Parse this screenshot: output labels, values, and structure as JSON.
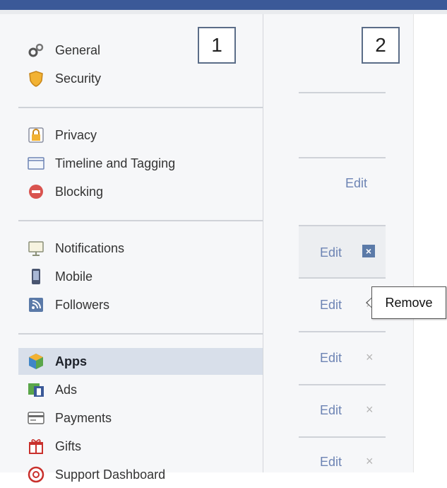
{
  "callouts": {
    "left": "1",
    "right": "2"
  },
  "sidebar": {
    "groups": [
      {
        "items": [
          {
            "label": "General",
            "icon": "gears-icon"
          },
          {
            "label": "Security",
            "icon": "shield-icon"
          }
        ]
      },
      {
        "items": [
          {
            "label": "Privacy",
            "icon": "lock-icon"
          },
          {
            "label": "Timeline and Tagging",
            "icon": "timeline-icon"
          },
          {
            "label": "Blocking",
            "icon": "blocking-icon"
          }
        ]
      },
      {
        "items": [
          {
            "label": "Notifications",
            "icon": "notifications-icon"
          },
          {
            "label": "Mobile",
            "icon": "mobile-icon"
          },
          {
            "label": "Followers",
            "icon": "followers-icon"
          }
        ]
      },
      {
        "items": [
          {
            "label": "Apps",
            "icon": "apps-icon",
            "active": true
          },
          {
            "label": "Ads",
            "icon": "ads-icon"
          },
          {
            "label": "Payments",
            "icon": "payments-icon"
          },
          {
            "label": "Gifts",
            "icon": "gifts-icon"
          },
          {
            "label": "Support Dashboard",
            "icon": "support-icon"
          }
        ]
      }
    ]
  },
  "rows": {
    "edit_label": "Edit",
    "remove_symbol": "×"
  },
  "tooltip": {
    "text": "Remove"
  },
  "colors": {
    "header": "#3b5998",
    "link": "#6d84b4",
    "active_bg": "#d8dfea",
    "sidebar_bg": "#f6f7f9"
  }
}
